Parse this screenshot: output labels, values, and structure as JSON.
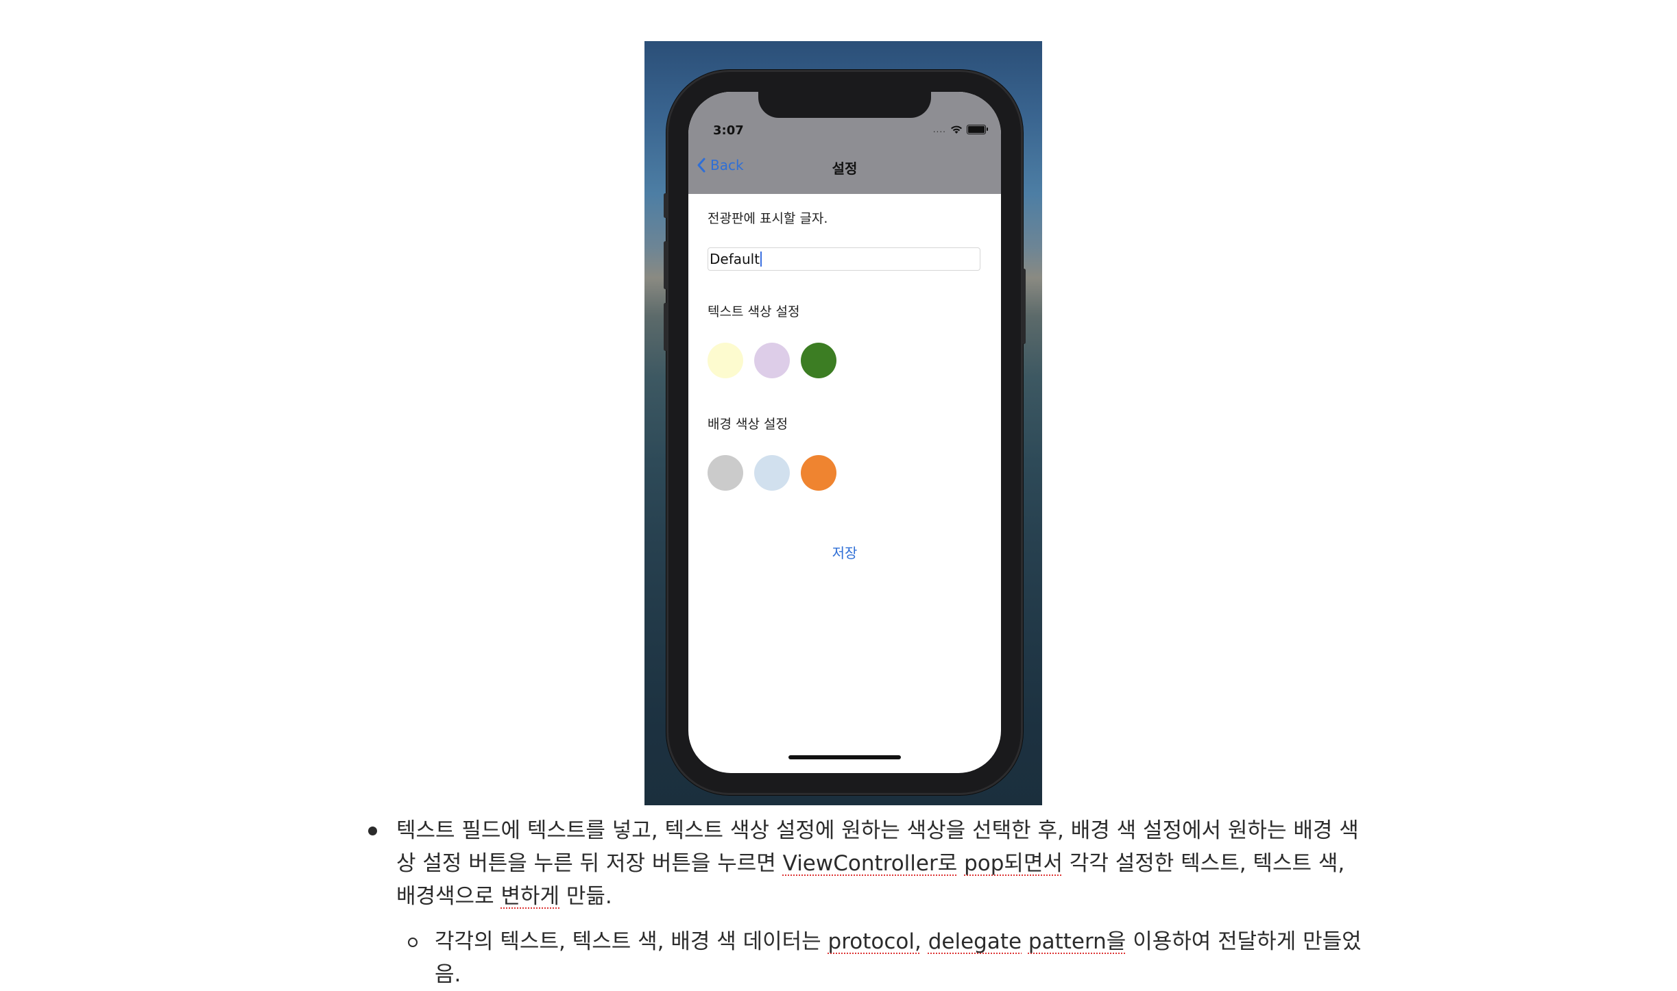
{
  "simulator": {
    "status_bar": {
      "time": "3:07"
    },
    "navbar": {
      "back_label": "Back",
      "title": "설정"
    },
    "display_text_label": "전광판에 표시할 글자.",
    "text_field_value": "Default",
    "text_color_label": "텍스트 색상 설정",
    "text_colors": [
      "#fdfbcf",
      "#ddcde8",
      "#3c7d23"
    ],
    "bg_color_label": "배경 색상 설정",
    "bg_colors": [
      "#cbcbcb",
      "#d1e0ee",
      "#ef8430"
    ],
    "save_label": "저장"
  },
  "doc": {
    "bullet1_line1": "텍스트 필드에 텍스트를 넣고, 텍스트 색상 설정에 원하는 색상을 선택한 후, 배경 색 설정에서 원하는 배경 색",
    "bullet1_line2_a": "상 설정 버튼을 누른 뒤 저장 버튼을 누르면 ",
    "bullet1_line2_b": "ViewController로",
    "bullet1_line2_c": " ",
    "bullet1_line2_d": "pop되면서",
    "bullet1_line2_e": " 각각 설정한 텍스트, 텍스트 색,",
    "bullet1_line3_a": "배경색으로 ",
    "bullet1_line3_b": "변하게",
    "bullet1_line3_c": " 만듦.",
    "bullet2_line1_a": "각각의 텍스트, 텍스트 색, 배경 색 데이터는 ",
    "bullet2_line1_b": "protocol,",
    "bullet2_line1_c": " ",
    "bullet2_line1_d": "delegate",
    "bullet2_line1_e": " ",
    "bullet2_line1_f": "pattern을",
    "bullet2_line1_g": " 이용하여 전달하게 만들었",
    "bullet2_line2": "음."
  }
}
